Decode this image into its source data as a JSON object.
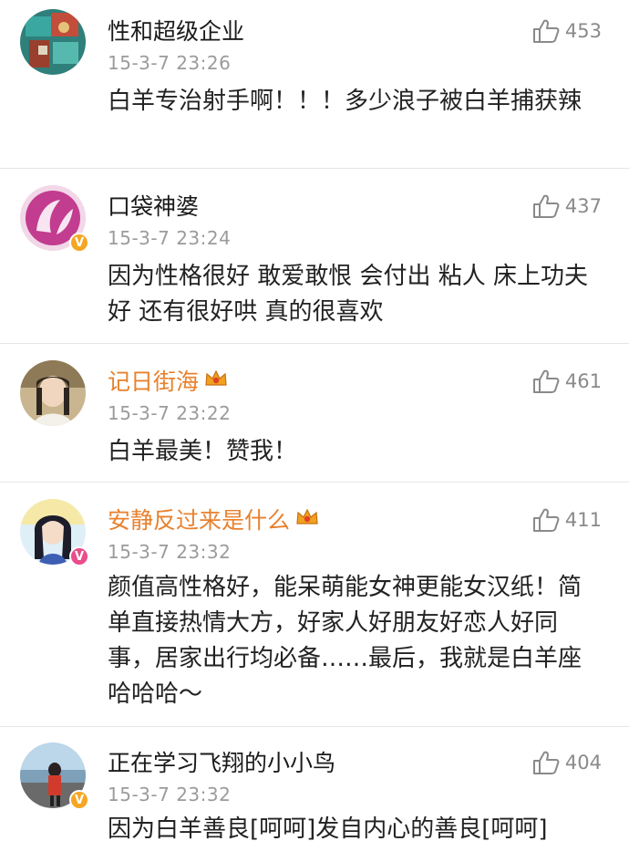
{
  "comments": [
    {
      "username": "性和超级企业",
      "timestamp": "15-3-7 23:26",
      "likes": "453",
      "text": "白羊专治射手啊！！！多少浪子被白羊捕获辣",
      "verified": false,
      "vip": false
    },
    {
      "username": "口袋神婆",
      "timestamp": "15-3-7 23:24",
      "likes": "437",
      "text": "因为性格很好 敢爱敢恨 会付出 粘人 床上功夫好 还有很好哄 真的很喜欢",
      "verified": true,
      "vip": false
    },
    {
      "username": "记日街海",
      "timestamp": "15-3-7 23:22",
      "likes": "461",
      "text": "白羊最美！赞我！",
      "verified": false,
      "vip": true
    },
    {
      "username": "安静反过来是什么",
      "timestamp": "15-3-7 23:32",
      "likes": "411",
      "text": "颜值高性格好，能呆萌能女神更能女汉纸！简单直接热情大方，好家人好朋友好恋人好同事，居家出行均必备……最后，我就是白羊座哈哈哈～",
      "verified": true,
      "vip": true
    },
    {
      "username": "正在学习飞翔的小小鸟",
      "timestamp": "15-3-7 23:32",
      "likes": "404",
      "text": "因为白羊善良[呵呵]发自内心的善良[呵呵]",
      "verified": true,
      "vip": false
    }
  ],
  "badges": {
    "verified_glyph": "V"
  },
  "colors": {
    "vip_name": "#e8812e",
    "timestamp": "#9b9b9b",
    "like": "#8a8a8a",
    "divider": "#e6e6e6",
    "verified_gold": "#f5a623",
    "verified_pink": "#e94d8a"
  },
  "icons": [
    "thumbs-up-icon",
    "crown-icon",
    "verified-badge-icon"
  ]
}
